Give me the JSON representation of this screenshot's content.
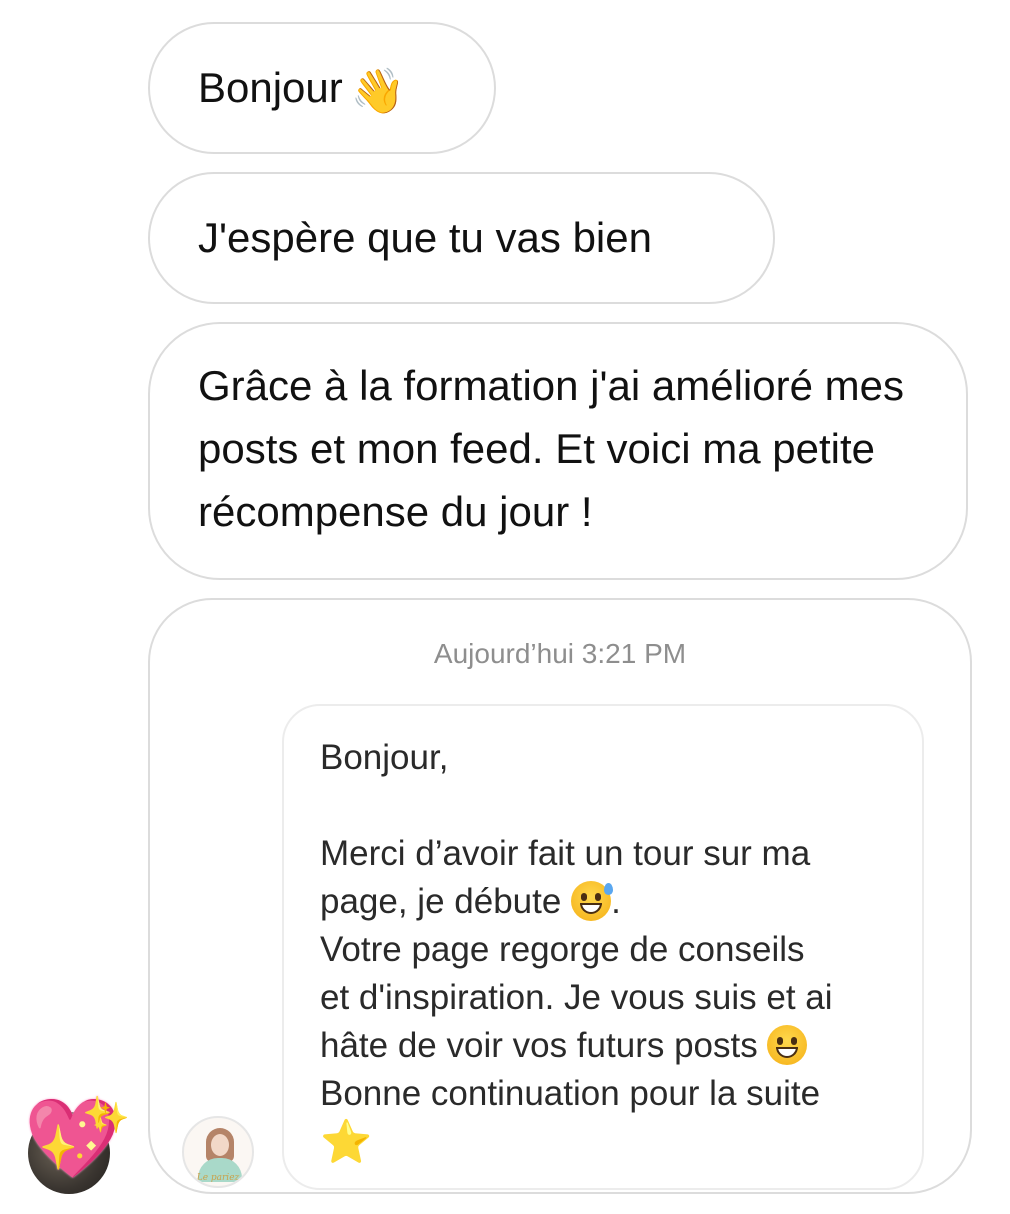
{
  "messages": [
    {
      "text": "Bonjour",
      "emoji": "👋"
    },
    {
      "text": "J'espère que tu vas bien"
    },
    {
      "text": "Grâce à la formation j'ai amélioré mes posts et mon feed. Et voici ma petite récompense du jour !"
    }
  ],
  "shared_screenshot": {
    "timestamp": "Aujourd’hui 3:21 PM",
    "greeting": "Bonjour,",
    "line1": "Merci d’avoir fait un tour sur ma",
    "line2a": "page, je débute ",
    "line2b": ".",
    "line3": "Votre page regorge de conseils",
    "line4": "et d'inspiration. Je vous suis et ai",
    "line5": "hâte de voir vos futurs posts ",
    "line6": "Bonne continuation pour la suite",
    "star": "⭐",
    "profile_signature": "Le pariez"
  },
  "sender_avatar": {
    "heart": "💖",
    "sparkles": "✨"
  }
}
